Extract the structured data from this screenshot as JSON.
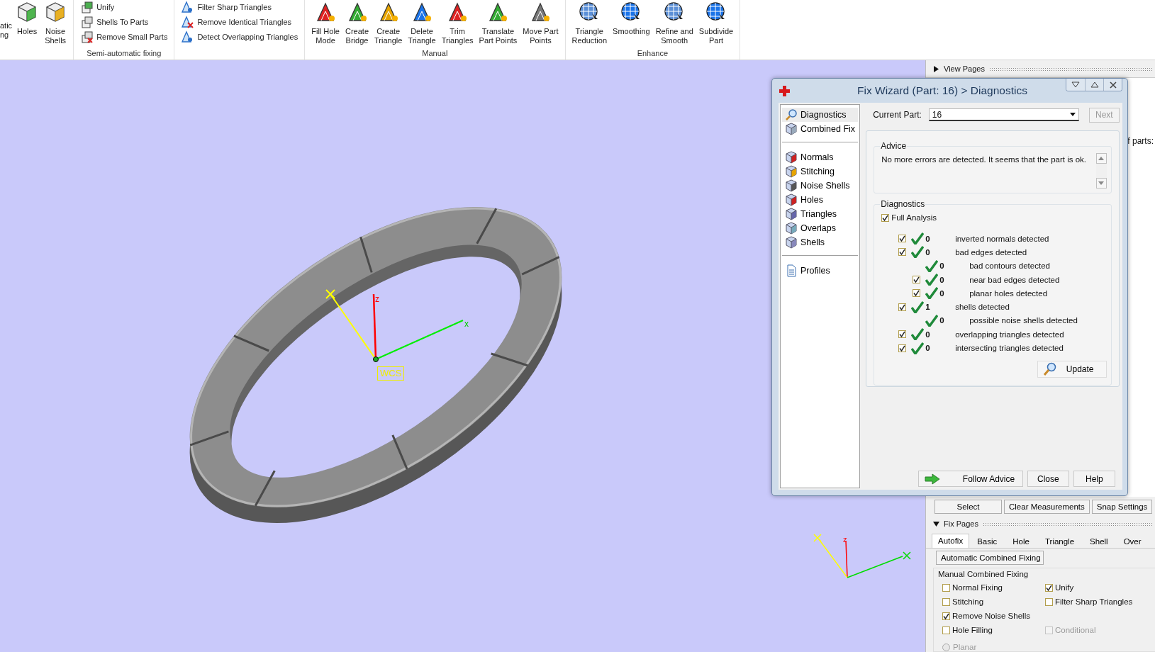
{
  "ribbon": {
    "groups": [
      {
        "kind": "large",
        "buttons": [
          {
            "kind": "text",
            "label": [
              "atic",
              "ng"
            ]
          },
          {
            "kind": "icon",
            "label": [
              "Holes"
            ]
          },
          {
            "kind": "icon",
            "label": [
              "Noise",
              "Shells"
            ]
          }
        ]
      },
      {
        "kind": "small",
        "label": "Semi-automatic fixing",
        "buttons": [
          {
            "label": "Unify"
          },
          {
            "label": "Shells To Parts"
          },
          {
            "label": "Remove Small Parts"
          }
        ]
      },
      {
        "kind": "small",
        "buttons": [
          {
            "label": "Filter Sharp Triangles"
          },
          {
            "label": "Remove Identical Triangles"
          },
          {
            "label": "Detect Overlapping Triangles"
          }
        ]
      },
      {
        "kind": "large",
        "label": "Manual",
        "buttons": [
          {
            "kind": "icon",
            "label": [
              "Fill Hole",
              "Mode"
            ]
          },
          {
            "kind": "icon",
            "label": [
              "Create",
              "Bridge"
            ]
          },
          {
            "kind": "icon",
            "label": [
              "Create",
              "Triangle"
            ]
          },
          {
            "kind": "icon",
            "label": [
              "Delete",
              "Triangle"
            ]
          },
          {
            "kind": "icon",
            "label": [
              "Trim",
              "Triangles"
            ]
          },
          {
            "kind": "icon",
            "label": [
              "Translate",
              "Part Points"
            ]
          },
          {
            "kind": "icon",
            "label": [
              "Move Part",
              "Points"
            ]
          }
        ]
      },
      {
        "kind": "large",
        "label": "Enhance",
        "buttons": [
          {
            "kind": "icon",
            "label": [
              "Triangle",
              "Reduction"
            ]
          },
          {
            "kind": "icon",
            "label": [
              "Smoothing"
            ]
          },
          {
            "kind": "icon",
            "label": [
              "Refine and",
              "Smooth"
            ]
          },
          {
            "kind": "icon",
            "label": [
              "Subdivide",
              "Part"
            ]
          }
        ]
      }
    ]
  },
  "viewport": {
    "main_axes": {
      "z_label": "z",
      "x_label": "x",
      "caption": "WCS"
    },
    "corner_axes": {
      "z_label": "z"
    }
  },
  "dialog": {
    "title": "Fix Wizard (Part: 16) > Diagnostics",
    "nav_sections": [
      [
        {
          "label": "Diagnostics",
          "selected": true
        },
        {
          "label": "Combined Fix",
          "selected": false
        }
      ],
      [
        {
          "label": "Normals",
          "selected": false
        },
        {
          "label": "Stitching",
          "selected": false
        },
        {
          "label": "Noise Shells",
          "selected": false
        },
        {
          "label": "Holes",
          "selected": false
        },
        {
          "label": "Triangles",
          "selected": false
        },
        {
          "label": "Overlaps",
          "selected": false
        },
        {
          "label": "Shells",
          "selected": false
        }
      ],
      [
        {
          "label": "Profiles",
          "selected": false
        }
      ]
    ],
    "current_part": {
      "label": "Current Part:",
      "value": "16"
    },
    "next_button": {
      "label": "Next",
      "disabled": true
    },
    "advice": {
      "title": "Advice",
      "text": "No more errors are detected. It seems that the part is ok."
    },
    "diagnostics": {
      "title": "Diagnostics",
      "full_analysis": {
        "label": "Full Analysis",
        "checked": true
      },
      "rows": [
        {
          "kind": "check",
          "checked": true,
          "count": "0",
          "label": "inverted normals detected"
        },
        {
          "kind": "check",
          "checked": true,
          "count": "0",
          "label": "bad edges detected",
          "children": [
            {
              "kind": "plain",
              "count": "0",
              "label": "bad contours detected"
            },
            {
              "kind": "check",
              "checked": true,
              "count": "0",
              "label": "near bad edges detected"
            },
            {
              "kind": "check",
              "checked": true,
              "count": "0",
              "label": "planar holes detected"
            }
          ]
        },
        {
          "kind": "check",
          "checked": true,
          "count": "1",
          "label": "shells detected",
          "children": [
            {
              "kind": "plain",
              "count": "0",
              "label": "possible noise shells detected"
            }
          ]
        },
        {
          "kind": "check",
          "checked": true,
          "count": "0",
          "label": "overlapping triangles detected"
        },
        {
          "kind": "check",
          "checked": true,
          "count": "0",
          "label": "intersecting triangles detected"
        }
      ]
    },
    "update_button": "Update",
    "buttons": [
      {
        "kind": "arrow",
        "label": "Follow Advice"
      },
      {
        "kind": "plain",
        "label": "Close"
      },
      {
        "kind": "plain",
        "label": "Help"
      }
    ]
  },
  "side_panel": {
    "view_pages": {
      "title": "View Pages",
      "expanded": false
    },
    "fragment_text": "f parts:",
    "toolbar": [
      "Select",
      "Clear Measurements",
      "Snap Settings"
    ],
    "fix_pages": {
      "title": "Fix Pages",
      "expanded": true,
      "tabs": [
        {
          "label": "Autofix",
          "selected": true
        },
        {
          "label": "Basic",
          "selected": false
        },
        {
          "label": "Hole",
          "selected": false
        },
        {
          "label": "Triangle",
          "selected": false
        },
        {
          "label": "Shell",
          "selected": false
        },
        {
          "label": "Over",
          "selected": false
        }
      ],
      "auto_button": "Automatic Combined Fixing",
      "group_title": "Manual Combined Fixing",
      "rows": [
        {
          "left": {
            "label": "Normal Fixing",
            "checked": false,
            "disabled": false
          },
          "right": {
            "label": "Unify",
            "checked": true,
            "disabled": false
          }
        },
        {
          "left": {
            "label": "Stitching",
            "checked": false,
            "disabled": false
          },
          "right": {
            "label": "Filter Sharp Triangles",
            "checked": false,
            "disabled": false
          }
        },
        {
          "left": {
            "label": "Remove Noise Shells",
            "checked": true,
            "disabled": false
          }
        },
        {
          "left": {
            "label": "Hole Filling",
            "checked": false,
            "disabled": false
          },
          "right": {
            "label": "Conditional",
            "checked": false,
            "disabled": true
          }
        }
      ],
      "radio": {
        "label": "Planar",
        "selected": false,
        "disabled": true
      }
    }
  }
}
